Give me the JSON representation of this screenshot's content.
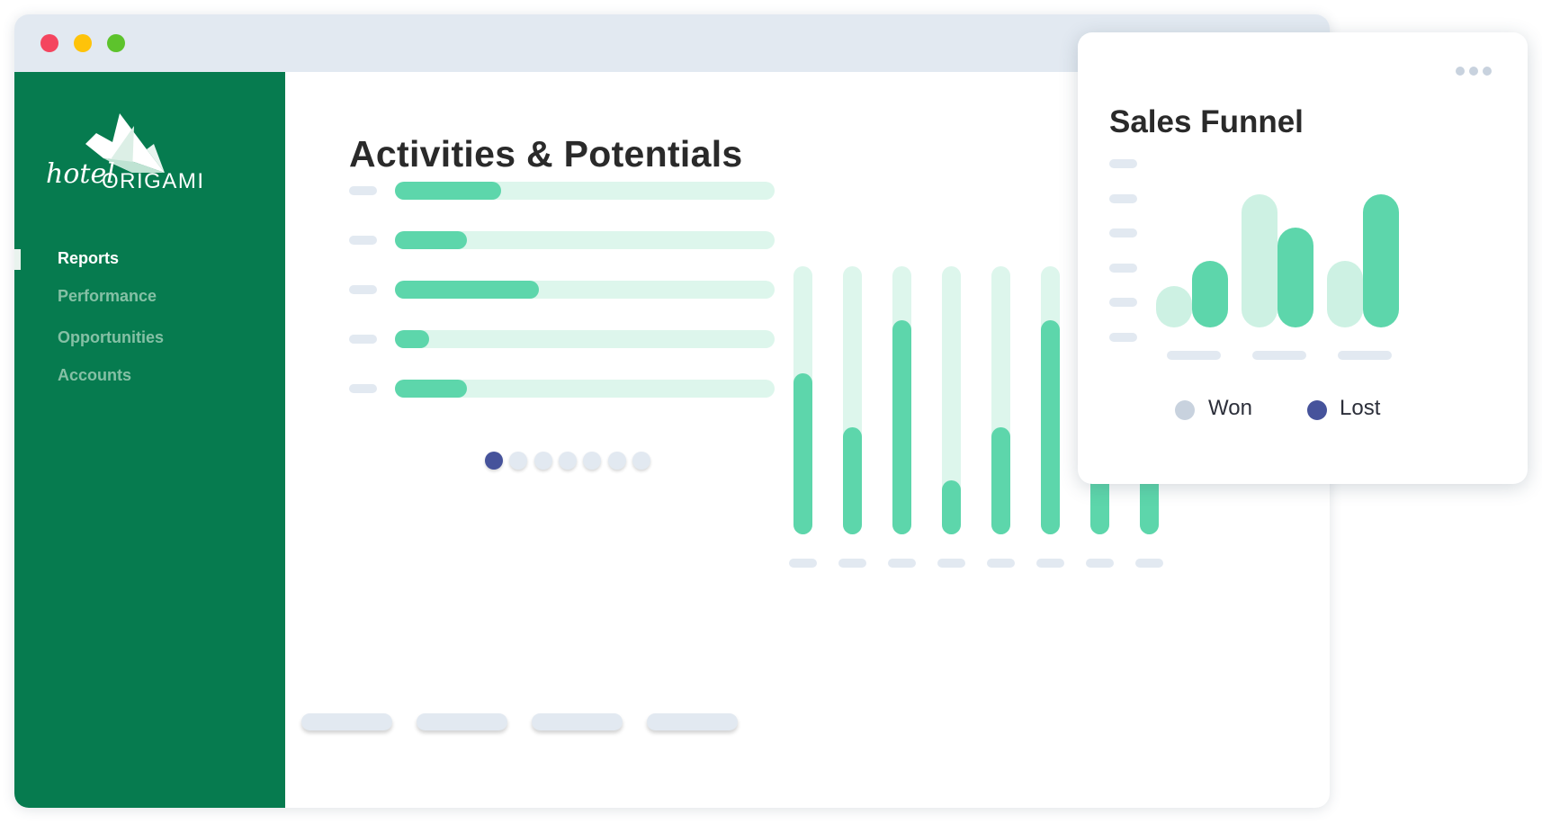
{
  "app": {
    "brand": "hotel ORIGAMI",
    "brand_script": "hotel",
    "brand_caps": "ORIGAMI"
  },
  "window": {
    "controls": [
      {
        "name": "close",
        "color": "#f4455f"
      },
      {
        "name": "minimize",
        "color": "#fec30a"
      },
      {
        "name": "maximize",
        "color": "#5dc32c"
      }
    ]
  },
  "sidebar": {
    "background": "#067b4f",
    "items": [
      {
        "label": "Reports",
        "active": true
      },
      {
        "label": "Performance",
        "active": false
      },
      {
        "label": "Opportunities",
        "active": false
      },
      {
        "label": "Accounts",
        "active": false
      }
    ]
  },
  "main": {
    "title": "Activities & Potentials",
    "activities": {
      "type": "horizontal-progress",
      "values": [
        0.28,
        0.19,
        0.38,
        0.09,
        0.19
      ]
    },
    "pager": {
      "count": 7,
      "active_index": 0
    },
    "column_chart": {
      "type": "bar",
      "value_fractions": [
        0.6,
        0.4,
        0.8,
        0.2,
        0.4,
        0.8,
        1.0,
        1.0
      ]
    },
    "footer_pills": 4
  },
  "sales_funnel": {
    "title": "Sales Funnel",
    "menu_icon": "more-horizontal-icon"
  },
  "chart_data": {
    "type": "bar",
    "title": "Sales Funnel",
    "categories": [
      "",
      "",
      ""
    ],
    "series": [
      {
        "name": "Won",
        "values": [
          0.31,
          1.0,
          0.5
        ],
        "color": "#cdf1e3"
      },
      {
        "name": "Lost",
        "values": [
          0.5,
          0.75,
          1.0
        ],
        "color": "#5dd6ab"
      }
    ],
    "legend": [
      {
        "label": "Won",
        "color": "#c8d2de"
      },
      {
        "label": "Lost",
        "color": "#46539b"
      }
    ],
    "legend_position": "bottom",
    "ylim": [
      0,
      1
    ],
    "grid": false
  },
  "colors": {
    "accent": "#5dd6ab",
    "accent_light": "#ddf6ec",
    "titlebar": "#e2e9f1",
    "pager_active": "#46539b"
  }
}
